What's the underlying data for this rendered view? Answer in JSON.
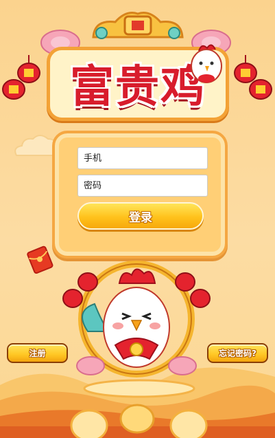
{
  "title": "富贵鸡",
  "login_form": {
    "phone_placeholder": "手机",
    "password_placeholder": "密码",
    "login_label": "登录"
  },
  "footer": {
    "register_label": "注册",
    "forgot_label": "忘记密码?"
  },
  "colors": {
    "background": "#fbd89a",
    "title_red": "#d81c2c",
    "button_yellow": "#ffc21c",
    "panel": "#ffcf76"
  }
}
